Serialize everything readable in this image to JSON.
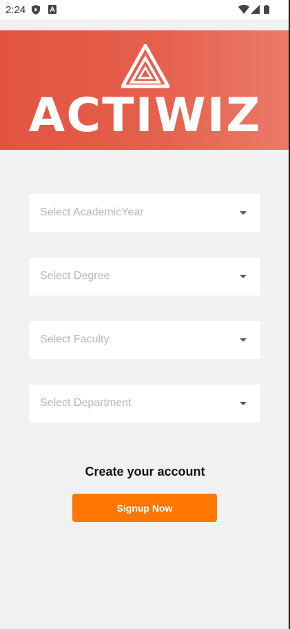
{
  "status_bar": {
    "time": "2:24",
    "icons": [
      "shield-play-icon",
      "a-box-icon",
      "wifi-icon",
      "signal-icon",
      "battery-icon"
    ]
  },
  "brand": {
    "name": "ACTIWIZ",
    "logo": "triangle-logo",
    "header_color": "#e25440"
  },
  "form": {
    "selects": [
      {
        "placeholder": "Select AcademicYear"
      },
      {
        "placeholder": "Select Degree"
      },
      {
        "placeholder": "Select Faculty"
      },
      {
        "placeholder": "Select Department"
      }
    ]
  },
  "cta": {
    "heading": "Create your account",
    "button_label": "Signup Now",
    "button_color": "#ff7700"
  }
}
